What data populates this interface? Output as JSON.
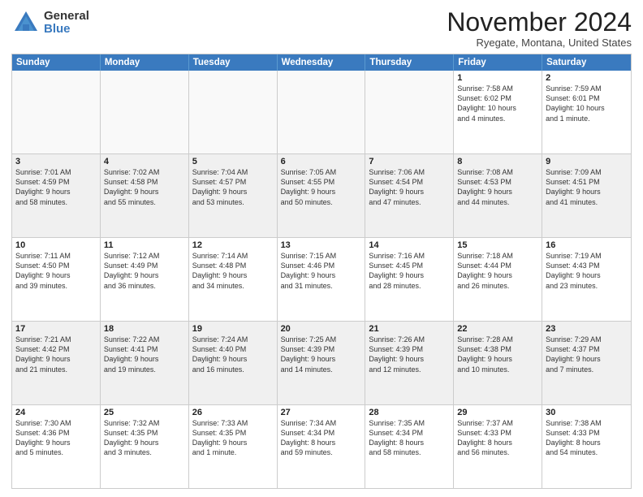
{
  "logo": {
    "general": "General",
    "blue": "Blue"
  },
  "title": "November 2024",
  "location": "Ryegate, Montana, United States",
  "days_of_week": [
    "Sunday",
    "Monday",
    "Tuesday",
    "Wednesday",
    "Thursday",
    "Friday",
    "Saturday"
  ],
  "weeks": [
    [
      {
        "day": "",
        "text": "",
        "empty": true
      },
      {
        "day": "",
        "text": "",
        "empty": true
      },
      {
        "day": "",
        "text": "",
        "empty": true
      },
      {
        "day": "",
        "text": "",
        "empty": true
      },
      {
        "day": "",
        "text": "",
        "empty": true
      },
      {
        "day": "1",
        "text": "Sunrise: 7:58 AM\nSunset: 6:02 PM\nDaylight: 10 hours\nand 4 minutes.",
        "empty": false
      },
      {
        "day": "2",
        "text": "Sunrise: 7:59 AM\nSunset: 6:01 PM\nDaylight: 10 hours\nand 1 minute.",
        "empty": false
      }
    ],
    [
      {
        "day": "3",
        "text": "Sunrise: 7:01 AM\nSunset: 4:59 PM\nDaylight: 9 hours\nand 58 minutes.",
        "empty": false
      },
      {
        "day": "4",
        "text": "Sunrise: 7:02 AM\nSunset: 4:58 PM\nDaylight: 9 hours\nand 55 minutes.",
        "empty": false
      },
      {
        "day": "5",
        "text": "Sunrise: 7:04 AM\nSunset: 4:57 PM\nDaylight: 9 hours\nand 53 minutes.",
        "empty": false
      },
      {
        "day": "6",
        "text": "Sunrise: 7:05 AM\nSunset: 4:55 PM\nDaylight: 9 hours\nand 50 minutes.",
        "empty": false
      },
      {
        "day": "7",
        "text": "Sunrise: 7:06 AM\nSunset: 4:54 PM\nDaylight: 9 hours\nand 47 minutes.",
        "empty": false
      },
      {
        "day": "8",
        "text": "Sunrise: 7:08 AM\nSunset: 4:53 PM\nDaylight: 9 hours\nand 44 minutes.",
        "empty": false
      },
      {
        "day": "9",
        "text": "Sunrise: 7:09 AM\nSunset: 4:51 PM\nDaylight: 9 hours\nand 41 minutes.",
        "empty": false
      }
    ],
    [
      {
        "day": "10",
        "text": "Sunrise: 7:11 AM\nSunset: 4:50 PM\nDaylight: 9 hours\nand 39 minutes.",
        "empty": false
      },
      {
        "day": "11",
        "text": "Sunrise: 7:12 AM\nSunset: 4:49 PM\nDaylight: 9 hours\nand 36 minutes.",
        "empty": false
      },
      {
        "day": "12",
        "text": "Sunrise: 7:14 AM\nSunset: 4:48 PM\nDaylight: 9 hours\nand 34 minutes.",
        "empty": false
      },
      {
        "day": "13",
        "text": "Sunrise: 7:15 AM\nSunset: 4:46 PM\nDaylight: 9 hours\nand 31 minutes.",
        "empty": false
      },
      {
        "day": "14",
        "text": "Sunrise: 7:16 AM\nSunset: 4:45 PM\nDaylight: 9 hours\nand 28 minutes.",
        "empty": false
      },
      {
        "day": "15",
        "text": "Sunrise: 7:18 AM\nSunset: 4:44 PM\nDaylight: 9 hours\nand 26 minutes.",
        "empty": false
      },
      {
        "day": "16",
        "text": "Sunrise: 7:19 AM\nSunset: 4:43 PM\nDaylight: 9 hours\nand 23 minutes.",
        "empty": false
      }
    ],
    [
      {
        "day": "17",
        "text": "Sunrise: 7:21 AM\nSunset: 4:42 PM\nDaylight: 9 hours\nand 21 minutes.",
        "empty": false
      },
      {
        "day": "18",
        "text": "Sunrise: 7:22 AM\nSunset: 4:41 PM\nDaylight: 9 hours\nand 19 minutes.",
        "empty": false
      },
      {
        "day": "19",
        "text": "Sunrise: 7:24 AM\nSunset: 4:40 PM\nDaylight: 9 hours\nand 16 minutes.",
        "empty": false
      },
      {
        "day": "20",
        "text": "Sunrise: 7:25 AM\nSunset: 4:39 PM\nDaylight: 9 hours\nand 14 minutes.",
        "empty": false
      },
      {
        "day": "21",
        "text": "Sunrise: 7:26 AM\nSunset: 4:39 PM\nDaylight: 9 hours\nand 12 minutes.",
        "empty": false
      },
      {
        "day": "22",
        "text": "Sunrise: 7:28 AM\nSunset: 4:38 PM\nDaylight: 9 hours\nand 10 minutes.",
        "empty": false
      },
      {
        "day": "23",
        "text": "Sunrise: 7:29 AM\nSunset: 4:37 PM\nDaylight: 9 hours\nand 7 minutes.",
        "empty": false
      }
    ],
    [
      {
        "day": "24",
        "text": "Sunrise: 7:30 AM\nSunset: 4:36 PM\nDaylight: 9 hours\nand 5 minutes.",
        "empty": false
      },
      {
        "day": "25",
        "text": "Sunrise: 7:32 AM\nSunset: 4:35 PM\nDaylight: 9 hours\nand 3 minutes.",
        "empty": false
      },
      {
        "day": "26",
        "text": "Sunrise: 7:33 AM\nSunset: 4:35 PM\nDaylight: 9 hours\nand 1 minute.",
        "empty": false
      },
      {
        "day": "27",
        "text": "Sunrise: 7:34 AM\nSunset: 4:34 PM\nDaylight: 8 hours\nand 59 minutes.",
        "empty": false
      },
      {
        "day": "28",
        "text": "Sunrise: 7:35 AM\nSunset: 4:34 PM\nDaylight: 8 hours\nand 58 minutes.",
        "empty": false
      },
      {
        "day": "29",
        "text": "Sunrise: 7:37 AM\nSunset: 4:33 PM\nDaylight: 8 hours\nand 56 minutes.",
        "empty": false
      },
      {
        "day": "30",
        "text": "Sunrise: 7:38 AM\nSunset: 4:33 PM\nDaylight: 8 hours\nand 54 minutes.",
        "empty": false
      }
    ]
  ]
}
